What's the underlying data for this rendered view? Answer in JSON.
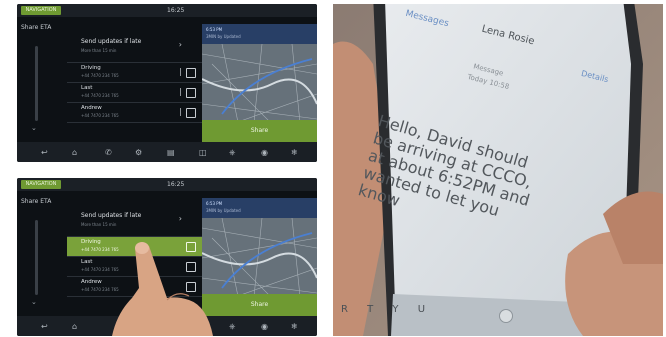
{
  "screen1": {
    "nav_badge": "NAVIGATION",
    "clock": "16:25",
    "share_eta": "Share ETA",
    "header_title": "Send updates if late",
    "header_sub": "More than 15 min",
    "contacts": [
      {
        "name": "Driving",
        "detail": "+44 7470 234 765"
      },
      {
        "name": "Last",
        "detail": "+44 7470 234 765"
      },
      {
        "name": "Andrew",
        "detail": "+44 7470 234 765"
      }
    ],
    "map_eta": "6:53 PM",
    "map_sub": "3MIN by Updated",
    "share_button": "Share"
  },
  "screen2": {
    "nav_badge": "NAVIGATION",
    "clock": "16:25",
    "share_eta": "Share ETA",
    "header_title": "Send updates if late",
    "header_sub": "More than 15 min",
    "contacts": [
      {
        "name": "Driving",
        "detail": "+44 7470 234 765"
      },
      {
        "name": "Last",
        "detail": "+44 7470 234 765"
      },
      {
        "name": "Andrew",
        "detail": "+44 7470 234 765"
      }
    ],
    "map_eta": "6:53 PM",
    "map_sub": "3MIN by Updated",
    "share_button": "Share"
  },
  "phone": {
    "contact": "Lena Rosie",
    "back": "Messages",
    "details": "Details",
    "message_type": "Message",
    "message_time": "Today 10:58",
    "message": "Hello, David should be arriving at CCCO, at about 6:52PM and wanted to let you know",
    "message_link": "6:52PM"
  },
  "colors": {
    "accent": "#6f9a32",
    "map_head": "#283f66"
  }
}
